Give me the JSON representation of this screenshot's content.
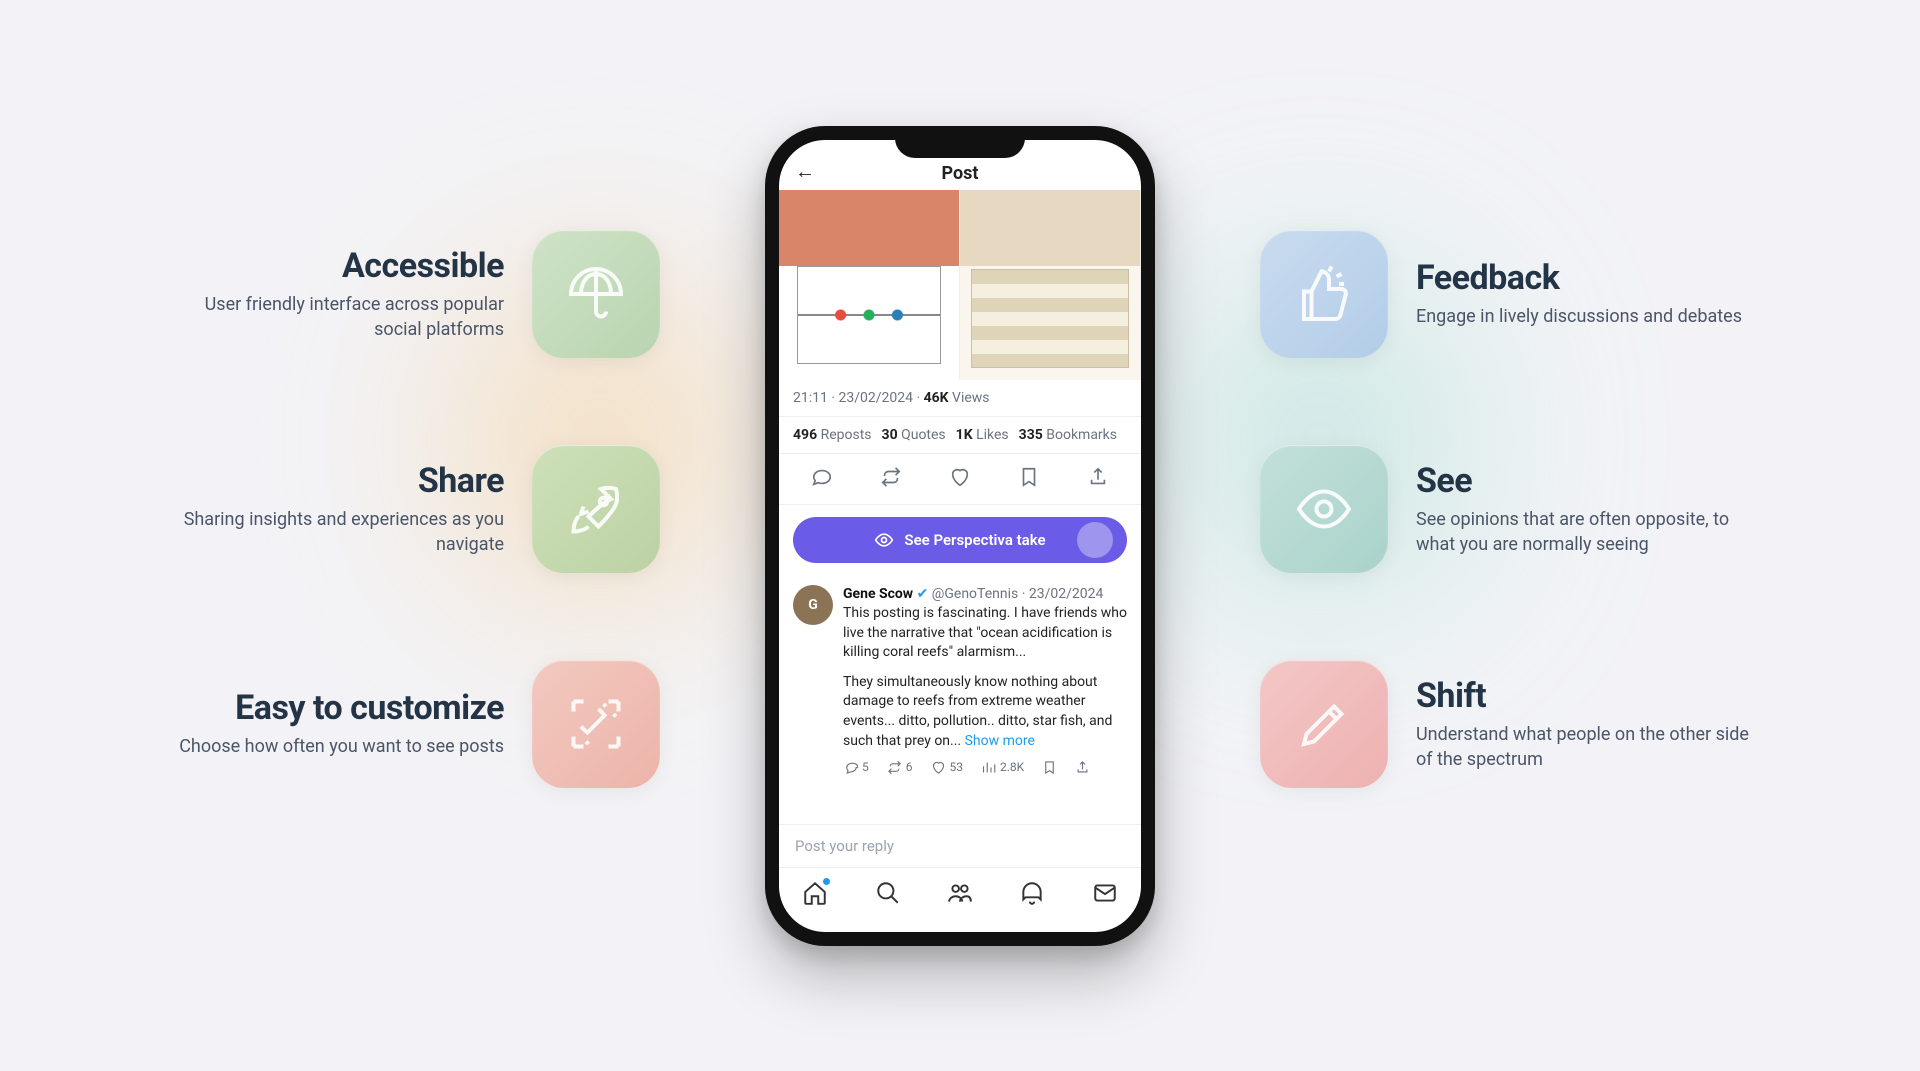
{
  "features": {
    "accessible": {
      "title": "Accessible",
      "desc": "User friendly interface across popular social platforms"
    },
    "share": {
      "title": "Share",
      "desc": "Sharing insights and experiences as you navigate"
    },
    "customize": {
      "title": "Easy to customize",
      "desc": "Choose how often you want to see posts"
    },
    "feedback": {
      "title": "Feedback",
      "desc": "Engage in lively discussions and debates"
    },
    "see": {
      "title": "See",
      "desc": "See opinions that are often opposite, to what you are normally seeing"
    },
    "shift": {
      "title": "Shift",
      "desc": "Understand what people on the other side of the spectrum"
    }
  },
  "phone": {
    "header_title": "Post",
    "meta": {
      "time": "21:11",
      "date": "23/02/2024",
      "views_num": "46K",
      "views_label": "Views"
    },
    "stats": {
      "reposts_num": "496",
      "reposts_label": "Reposts",
      "quotes_num": "30",
      "quotes_label": "Quotes",
      "likes_num": "1K",
      "likes_label": "Likes",
      "bookmarks_num": "335",
      "bookmarks_label": "Bookmarks"
    },
    "cta_label": "See Perspectiva take",
    "reply": {
      "avatar_initial": "G",
      "name": "Gene Scow",
      "handle": "@GenoTennis",
      "date": "23/02/2024",
      "body1": "This posting is fascinating.  I have friends who live the narrative that \"ocean acidification is killing coral reefs\" alarmism...",
      "body2": "They simultaneously know nothing about damage to reefs from extreme weather events... ditto,  pollution.. ditto, star fish, and such that prey on... ",
      "show_more": "Show more",
      "counts": {
        "replies": "5",
        "reposts": "6",
        "likes": "53",
        "views": "2.8K"
      }
    },
    "compose_placeholder": "Post your reply"
  }
}
